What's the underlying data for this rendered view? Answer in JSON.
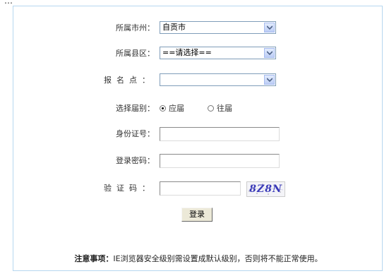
{
  "header": {
    "cut_text": "…"
  },
  "form": {
    "city": {
      "label": "所属市州：",
      "value": "自贡市"
    },
    "county": {
      "label": "所属县区：",
      "value": "==请选择=="
    },
    "exam_site": {
      "label": "报名点：",
      "value": ""
    },
    "session": {
      "label": "选择届别：",
      "options": [
        "应届",
        "往届"
      ],
      "selected": "应届"
    },
    "id_number": {
      "label": "身份证号：",
      "value": ""
    },
    "password": {
      "label": "登录密码：",
      "value": ""
    },
    "captcha": {
      "label": "验证码：",
      "value": "",
      "image_text": "8Z8N"
    },
    "submit_label": "登录"
  },
  "notice": {
    "label": "注意事项：",
    "text": "IE浏览器安全级别需设置成默认级别，否则将不能正常使用。"
  }
}
